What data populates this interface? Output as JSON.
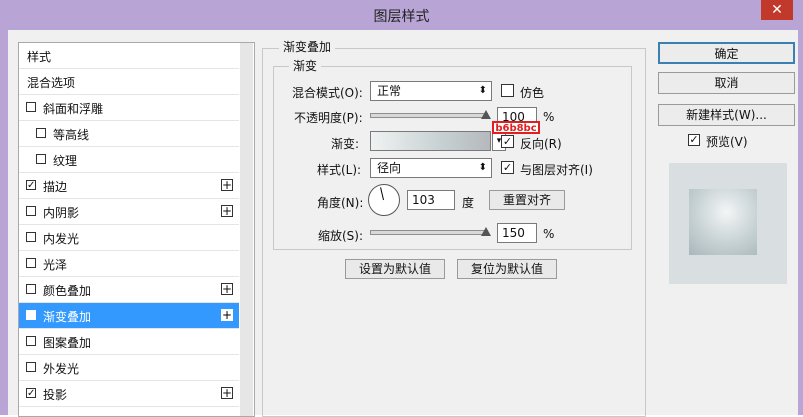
{
  "window": {
    "title": "图层样式",
    "close_label": "✕"
  },
  "left_list": [
    {
      "label": "样式",
      "checkbox": false,
      "checked": false,
      "plus": false,
      "selected": false,
      "indent": 0
    },
    {
      "label": "混合选项",
      "checkbox": false,
      "checked": false,
      "plus": false,
      "selected": false,
      "indent": 0
    },
    {
      "label": "斜面和浮雕",
      "checkbox": true,
      "checked": false,
      "plus": false,
      "selected": false,
      "indent": 0
    },
    {
      "label": "等高线",
      "checkbox": true,
      "checked": false,
      "plus": false,
      "selected": false,
      "indent": 1
    },
    {
      "label": "纹理",
      "checkbox": true,
      "checked": false,
      "plus": false,
      "selected": false,
      "indent": 1
    },
    {
      "label": "描边",
      "checkbox": true,
      "checked": true,
      "plus": true,
      "selected": false,
      "indent": 0
    },
    {
      "label": "内阴影",
      "checkbox": true,
      "checked": false,
      "plus": true,
      "selected": false,
      "indent": 0
    },
    {
      "label": "内发光",
      "checkbox": true,
      "checked": false,
      "plus": false,
      "selected": false,
      "indent": 0
    },
    {
      "label": "光泽",
      "checkbox": true,
      "checked": false,
      "plus": false,
      "selected": false,
      "indent": 0
    },
    {
      "label": "颜色叠加",
      "checkbox": true,
      "checked": false,
      "plus": true,
      "selected": false,
      "indent": 0
    },
    {
      "label": "渐变叠加",
      "checkbox": true,
      "checked": true,
      "plus": true,
      "selected": true,
      "indent": 0
    },
    {
      "label": "图案叠加",
      "checkbox": true,
      "checked": false,
      "plus": false,
      "selected": false,
      "indent": 0
    },
    {
      "label": "外发光",
      "checkbox": true,
      "checked": false,
      "plus": false,
      "selected": false,
      "indent": 0
    },
    {
      "label": "投影",
      "checkbox": true,
      "checked": true,
      "plus": true,
      "selected": false,
      "indent": 0
    }
  ],
  "panel": {
    "outer_title": "渐变叠加",
    "inner_title": "渐变",
    "blend_mode_label": "混合模式(O):",
    "blend_mode_value": "正常",
    "dither_label": "仿色",
    "opacity_label": "不透明度(P):",
    "opacity_value": "100",
    "opacity_fraction": 1.0,
    "percent": "%",
    "gradient_label": "渐变:",
    "gradient_hex": "b6b8bc",
    "reverse_label": "反向(R)",
    "style_label": "样式(L):",
    "style_value": "径向",
    "align_label": "与图层对齐(I)",
    "angle_label": "角度(N):",
    "angle_value": "103",
    "degree": "度",
    "reset_align": "重置对齐",
    "scale_label": "缩放(S):",
    "scale_value": "150",
    "scale_fraction": 1.0,
    "set_default": "设置为默认值",
    "reset_default": "复位为默认值"
  },
  "right": {
    "ok": "确定",
    "cancel": "取消",
    "new_style": "新建样式(W)...",
    "preview_label": "预览(V)"
  },
  "check_mark": "✓",
  "plus_mark": "+"
}
